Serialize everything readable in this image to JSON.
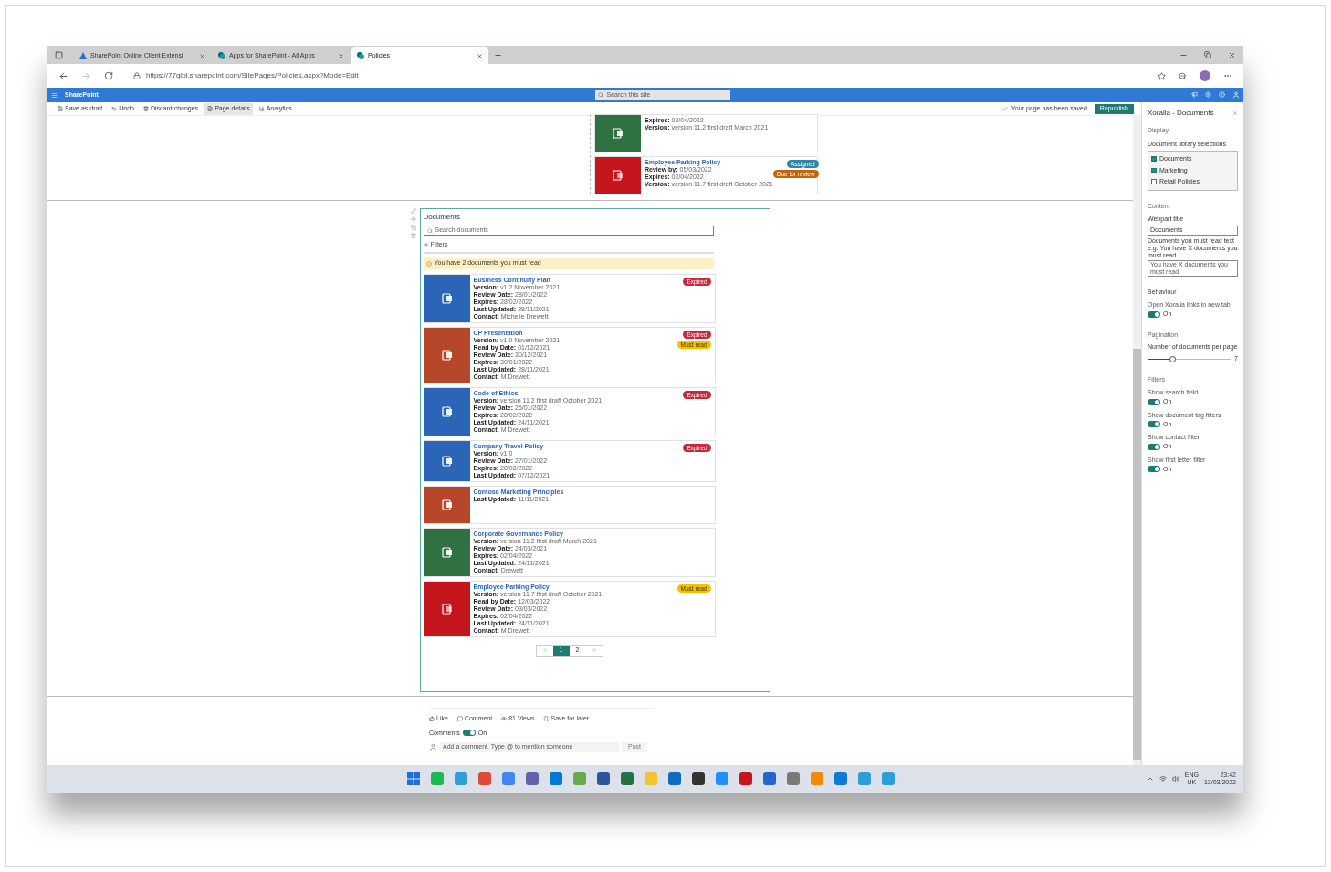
{
  "browser": {
    "tabs": [
      {
        "title": "SharePoint Online Client Extensi",
        "kind": "azure",
        "selected": false
      },
      {
        "title": "Apps for SharePoint - All Apps",
        "kind": "sharepoint",
        "selected": false
      },
      {
        "title": "Policies",
        "kind": "sharepoint",
        "selected": true
      }
    ],
    "url": "https://77glbl.sharepoint.com/SitePages/Policies.aspx?Mode=Edit"
  },
  "suite_bar": {
    "app_name": "SharePoint",
    "search_placeholder": "Search this site"
  },
  "command_bar": {
    "actions": [
      {
        "label": "Save as draft",
        "selected": false
      },
      {
        "label": "Undo",
        "selected": false
      },
      {
        "label": "Discard changes",
        "selected": false
      },
      {
        "label": "Page details",
        "selected": true
      },
      {
        "label": "Analytics",
        "selected": false
      }
    ],
    "status": "Your page has been saved",
    "publish_button": "Republish"
  },
  "previous_section": {
    "cards": [
      {
        "kind": "excel",
        "fields": [
          {
            "label": "Expires:",
            "value": "02/04/2022"
          },
          {
            "label": "Version:",
            "value": "version 11.2 first draft March 2021"
          }
        ]
      },
      {
        "title": "Employee Parking Policy",
        "kind": "pdf",
        "fields": [
          {
            "label": "Review by:",
            "value": "05/03/2022"
          },
          {
            "label": "Expires:",
            "value": "02/04/2022"
          },
          {
            "label": "Version:",
            "value": "version 11.7 first draft October 2021"
          }
        ],
        "badges": [
          {
            "label": "Assigned",
            "kind": "assigned"
          },
          {
            "label": "Due for review",
            "kind": "due"
          }
        ]
      }
    ]
  },
  "documents_webpart": {
    "title": "Documents",
    "search_placeholder": "Search documents",
    "filters_label": "Filters",
    "alert": "You have 2 documents you must read",
    "cards": [
      {
        "title": "Business Continuity Plan",
        "kind": "word",
        "fields": [
          {
            "label": "Version:",
            "value": "v1 2 November 2021"
          },
          {
            "label": "Review Date:",
            "value": "28/01/2022"
          },
          {
            "label": "Expires:",
            "value": "28/02/2022"
          },
          {
            "label": "Last Updated:",
            "value": "28/11/2021"
          },
          {
            "label": "Contact:",
            "value": "Michelle Drewett"
          }
        ],
        "badges": [
          {
            "label": "Expired",
            "kind": "expired"
          }
        ]
      },
      {
        "title": "CP Presentation",
        "kind": "powerpoint",
        "fields": [
          {
            "label": "Version:",
            "value": "v1 0 November 2021"
          },
          {
            "label": "Read by Date:",
            "value": "01/12/2021"
          },
          {
            "label": "Review Date:",
            "value": "30/12/2021"
          },
          {
            "label": "Expires:",
            "value": "30/01/2022"
          },
          {
            "label": "Last Updated:",
            "value": "28/11/2021"
          },
          {
            "label": "Contact:",
            "value": "M Drewett"
          }
        ],
        "badges": [
          {
            "label": "Expired",
            "kind": "expired"
          },
          {
            "label": "Must read",
            "kind": "must_read"
          }
        ]
      },
      {
        "title": "Code of Ethics",
        "kind": "word",
        "fields": [
          {
            "label": "Version:",
            "value": "version 11.2 first draft October 2021"
          },
          {
            "label": "Review Date:",
            "value": "26/01/2022"
          },
          {
            "label": "Expires:",
            "value": "28/02/2022"
          },
          {
            "label": "Last Updated:",
            "value": "24/11/2021"
          },
          {
            "label": "Contact:",
            "value": "M Drewett"
          }
        ],
        "badges": [
          {
            "label": "Expired",
            "kind": "expired"
          }
        ]
      },
      {
        "title": "Company Travel Policy",
        "kind": "word",
        "fields": [
          {
            "label": "Version:",
            "value": "v1.0"
          },
          {
            "label": "Review Date:",
            "value": "27/01/2022"
          },
          {
            "label": "Expires:",
            "value": "28/02/2022"
          },
          {
            "label": "Last Updated:",
            "value": "07/12/2021"
          }
        ],
        "badges": [
          {
            "label": "Expired",
            "kind": "expired"
          }
        ]
      },
      {
        "title": "Contoso Marketing Principles",
        "kind": "powerpoint",
        "fields": [
          {
            "label": "Last Updated:",
            "value": "11/11/2021"
          }
        ]
      },
      {
        "title": "Corporate Governance Policy",
        "kind": "excel",
        "fields": [
          {
            "label": "Version:",
            "value": "version 11.2 first draft March 2021"
          },
          {
            "label": "Review Date:",
            "value": "24/03/2021"
          },
          {
            "label": "Expires:",
            "value": "02/04/2022"
          },
          {
            "label": "Last Updated:",
            "value": "24/11/2021"
          },
          {
            "label": "Contact:",
            "value": "Drewett"
          }
        ]
      },
      {
        "title": "Employee Parking Policy",
        "kind": "pdf",
        "fields": [
          {
            "label": "Version:",
            "value": "version 11.7 first draft October 2021"
          },
          {
            "label": "Read by Date:",
            "value": "12/03/2022"
          },
          {
            "label": "Review Date:",
            "value": "03/03/2022"
          },
          {
            "label": "Expires:",
            "value": "02/04/2022"
          },
          {
            "label": "Last Updated:",
            "value": "24/11/2021"
          },
          {
            "label": "Contact:",
            "value": "M Drewett"
          }
        ],
        "badges": [
          {
            "label": "Must read",
            "kind": "must_read"
          }
        ]
      }
    ],
    "pagination": {
      "pages": [
        {
          "label": "1",
          "selected": true
        },
        {
          "label": "2",
          "selected": false
        }
      ]
    }
  },
  "footer": {
    "actions": [
      {
        "label": "Like",
        "kind": "like"
      },
      {
        "label": "Comment",
        "kind": "comment"
      },
      {
        "label": "81 Views",
        "kind": "views"
      },
      {
        "label": "Save for later",
        "kind": "save"
      }
    ],
    "comments_label": "Comments",
    "comments_toggle": {
      "on": true,
      "label": "On"
    },
    "comment_placeholder": "Add a comment. Type @ to mention someone",
    "post_button": "Post"
  },
  "property_pane": {
    "title": "Xoralia - Documents",
    "display": {
      "heading": "Display",
      "library_label": "Document library selections",
      "libraries": [
        {
          "label": "Documents",
          "checked": true
        },
        {
          "label": "Marketing",
          "checked": true
        },
        {
          "label": "Retail Policies",
          "checked": false
        }
      ]
    },
    "content": {
      "heading": "Content",
      "title_label": "Webpart title",
      "title_value": "Documents",
      "must_read_label": "Documents you must read text e.g. You have X documents you must read",
      "must_read_value": "You have X documents you must read"
    },
    "behaviour": {
      "heading": "Behaviour",
      "toggles": [
        {
          "label": "Open Xoralia links in new tab",
          "on": true,
          "state_label": "On"
        }
      ]
    },
    "pagination": {
      "heading": "Pagination",
      "label": "Number of documents per page",
      "level": 0.3,
      "reading": "7"
    },
    "filters": {
      "heading": "Filters",
      "toggles": [
        {
          "label": "Show search field",
          "on": true,
          "state_label": "On"
        },
        {
          "label": "Show document tag filters",
          "on": true,
          "state_label": "On"
        },
        {
          "label": "Show contact filter",
          "on": true,
          "state_label": "On"
        },
        {
          "label": "Show first letter filter",
          "on": true,
          "state_label": "On"
        }
      ]
    }
  },
  "taskbar": {
    "language": "ENG",
    "region": "UK",
    "time": "23:42",
    "date": "13/03/2022"
  }
}
